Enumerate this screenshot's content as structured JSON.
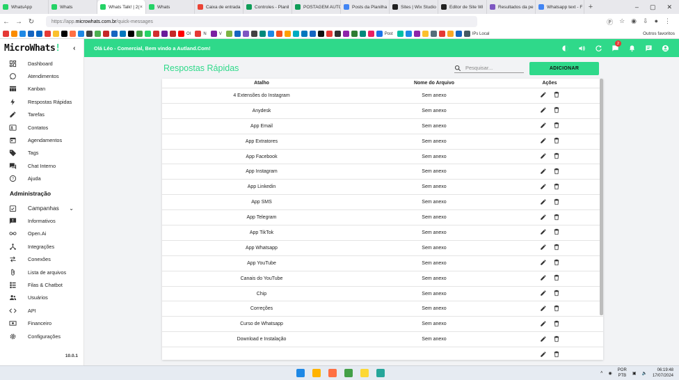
{
  "browser": {
    "tabs": [
      {
        "label": "WhatsApp",
        "color": "#25d366"
      },
      {
        "label": "Whats",
        "color": "#25d366"
      },
      {
        "label": "Whats Talk! | 2(",
        "color": "#25d366",
        "active": true
      },
      {
        "label": "Whats",
        "color": "#25d366"
      },
      {
        "label": "Caixa de entrada",
        "color": "#ea4335"
      },
      {
        "label": "Controles - Planil",
        "color": "#0f9d58"
      },
      {
        "label": "POSTAGEM AUTO",
        "color": "#0f9d58"
      },
      {
        "label": "Posts da Planilha",
        "color": "#4285f4"
      },
      {
        "label": "Sites | Wix Studio",
        "color": "#222222"
      },
      {
        "label": "Editor de Site Wi",
        "color": "#222222"
      },
      {
        "label": "Resultados da pe",
        "color": "#7e57c2"
      },
      {
        "label": "Whatsapp text - F",
        "color": "#4285f4"
      }
    ],
    "new_tab": "+",
    "url_prefix": "https://app.",
    "url_domain": "microwhats.com.br",
    "url_path": "/quick-messages",
    "bookmarks": [
      {
        "color": "#e53935"
      },
      {
        "color": "#fb8c00"
      },
      {
        "color": "#1e88e5"
      },
      {
        "color": "#1565c0"
      },
      {
        "color": "#0a66c2"
      },
      {
        "color": "#e53935"
      },
      {
        "color": "#fbc02d"
      },
      {
        "color": "#000000"
      },
      {
        "color": "#ff7043"
      },
      {
        "color": "#1e88e5"
      },
      {
        "color": "#424242"
      },
      {
        "color": "#4caf50"
      },
      {
        "color": "#c62828"
      },
      {
        "color": "#1565c0"
      },
      {
        "color": "#0277bd"
      },
      {
        "color": "#000000"
      },
      {
        "color": "#43a047"
      },
      {
        "color": "#25d366"
      },
      {
        "color": "#d32f2f"
      },
      {
        "color": "#6a1b9a"
      },
      {
        "color": "#c62828"
      },
      {
        "color": "#ff0000",
        "label": "OI"
      },
      {
        "color": "#e53935",
        "label": "N"
      },
      {
        "color": "#7b1fa2",
        "label": "V"
      },
      {
        "color": "#7cb342"
      },
      {
        "color": "#1565c0"
      },
      {
        "color": "#7e57c2"
      },
      {
        "color": "#424242"
      },
      {
        "color": "#00897b"
      },
      {
        "color": "#1e88e5"
      },
      {
        "color": "#f4511e"
      },
      {
        "color": "#ffa000"
      },
      {
        "color": "#00acc1"
      },
      {
        "color": "#0277bd"
      },
      {
        "color": "#1565c0"
      },
      {
        "color": "#111111"
      },
      {
        "color": "#e53935"
      },
      {
        "color": "#303030"
      },
      {
        "color": "#8e24aa"
      },
      {
        "color": "#2e7d32"
      },
      {
        "color": "#00897b"
      },
      {
        "color": "#e91e63"
      },
      {
        "color": "#1a73e8",
        "label": "Post"
      },
      {
        "color": "#00bfa5"
      },
      {
        "color": "#1e88e5"
      },
      {
        "color": "#8e24aa"
      },
      {
        "color": "#fbc02d"
      },
      {
        "color": "#546e7a"
      },
      {
        "color": "#e53935"
      },
      {
        "color": "#f9a825"
      },
      {
        "color": "#1565c0"
      },
      {
        "color": "#455a64",
        "label": "IPs Local"
      }
    ],
    "other_bookmarks": "Outros favoritos"
  },
  "app": {
    "logo_text": "MicroWhats",
    "logo_mark": "!",
    "collapse_icon": "chevron-left-icon",
    "greeting": "Olá Léo - Comercial, Bem vindo a Autland.Com!",
    "notification_count": "2",
    "version": "10.0.1"
  },
  "sidebar": {
    "items": [
      {
        "label": "Dashboard",
        "icon": "dashboard-icon"
      },
      {
        "label": "Atendimentos",
        "icon": "whatsapp-icon"
      },
      {
        "label": "Kanban",
        "icon": "kanban-icon"
      },
      {
        "label": "Respostas Rápidas",
        "icon": "bolt-icon"
      },
      {
        "label": "Tarefas",
        "icon": "pencil-icon"
      },
      {
        "label": "Contatos",
        "icon": "contacts-icon"
      },
      {
        "label": "Agendamentos",
        "icon": "calendar-icon"
      },
      {
        "label": "Tags",
        "icon": "tag-icon"
      },
      {
        "label": "Chat Interno",
        "icon": "chat-icon"
      },
      {
        "label": "Ajuda",
        "icon": "help-icon"
      }
    ],
    "admin_header": "Administração",
    "campaigns_label": "Campanhas",
    "admin_items": [
      {
        "label": "Informativos",
        "icon": "announcement-icon"
      },
      {
        "label": "Open.Ai",
        "icon": "infinity-icon"
      },
      {
        "label": "Integrações",
        "icon": "hub-icon"
      },
      {
        "label": "Conexões",
        "icon": "swap-icon"
      },
      {
        "label": "Lista de arquivos",
        "icon": "attachment-icon"
      },
      {
        "label": "Filas & Chatbot",
        "icon": "queue-icon"
      },
      {
        "label": "Usuários",
        "icon": "users-icon"
      },
      {
        "label": "API",
        "icon": "code-icon"
      },
      {
        "label": "Financeiro",
        "icon": "money-icon"
      },
      {
        "label": "Configurações",
        "icon": "gear-icon"
      }
    ]
  },
  "page": {
    "title": "Respostas Rápidas",
    "search_placeholder": "Pesquisar...",
    "add_button": "ADICIONAR",
    "columns": [
      "Atalho",
      "Nome do Arquivo",
      "Ações"
    ],
    "rows": [
      {
        "shortcut": "4 Extensões do Instagram",
        "file": "Sem anexo"
      },
      {
        "shortcut": "Anydesk",
        "file": "Sem anexo"
      },
      {
        "shortcut": "App Email",
        "file": "Sem anexo"
      },
      {
        "shortcut": "App Extratores",
        "file": "Sem anexo"
      },
      {
        "shortcut": "App Facebook",
        "file": "Sem anexo"
      },
      {
        "shortcut": "App Instagram",
        "file": "Sem anexo"
      },
      {
        "shortcut": "App Linkedin",
        "file": "Sem anexo"
      },
      {
        "shortcut": "App SMS",
        "file": "Sem anexo"
      },
      {
        "shortcut": "App Telegram",
        "file": "Sem anexo"
      },
      {
        "shortcut": "App TikTok",
        "file": "Sem anexo"
      },
      {
        "shortcut": "App Whatsapp",
        "file": "Sem anexo"
      },
      {
        "shortcut": "App YouTube",
        "file": "Sem anexo"
      },
      {
        "shortcut": "Canais do YouTube",
        "file": "Sem anexo"
      },
      {
        "shortcut": "Chip",
        "file": "Sem anexo"
      },
      {
        "shortcut": "Correções",
        "file": "Sem anexo"
      },
      {
        "shortcut": "Curso de Whatsapp",
        "file": "Sem anexo"
      },
      {
        "shortcut": "Download e Instalação",
        "file": "Sem anexo"
      },
      {
        "shortcut": "",
        "file": ""
      }
    ]
  },
  "taskbar": {
    "apps": [
      {
        "name": "windows-start-icon",
        "color": "#1e88e5"
      },
      {
        "name": "file-explorer-icon",
        "color": "#ffb300"
      },
      {
        "name": "firefox-icon",
        "color": "#ff7043"
      },
      {
        "name": "chrome-icon",
        "color": "#43a047"
      },
      {
        "name": "app-icon",
        "color": "#fdd835"
      },
      {
        "name": "calculator-icon",
        "color": "#26a69a"
      }
    ],
    "lang_top": "POR",
    "lang_bottom": "PTB",
    "time": "06:19:48",
    "date": "17/07/2024"
  },
  "colors": {
    "accent": "#2fd98a",
    "badge": "#e53935"
  }
}
